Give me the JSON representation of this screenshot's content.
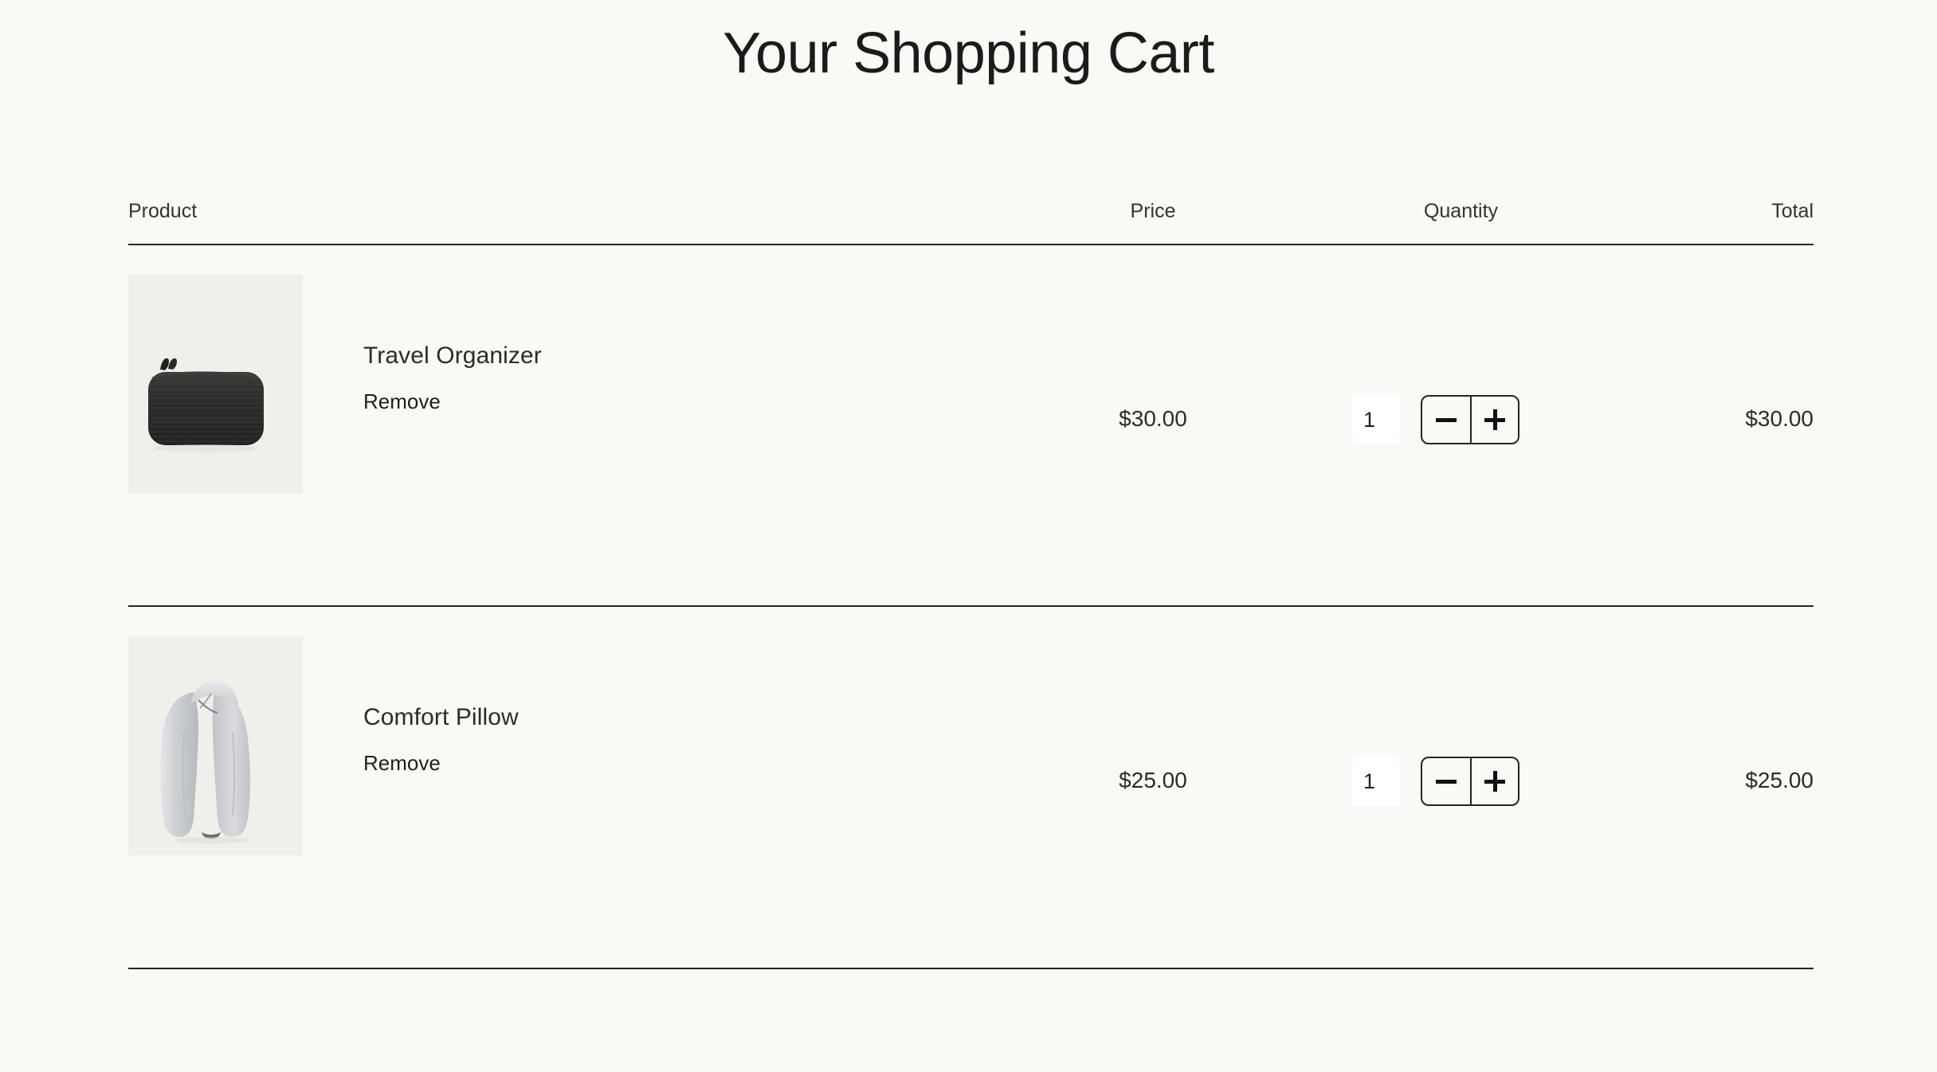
{
  "page": {
    "title": "Your Shopping Cart",
    "background_color": "#faf9f5",
    "divider_color": "#27271f",
    "text_color": "#1f1f1d"
  },
  "table": {
    "headers": {
      "product": "Product",
      "price": "Price",
      "quantity": "Quantity",
      "total": "Total"
    }
  },
  "items": [
    {
      "name": "Travel Organizer",
      "remove_label": "Remove",
      "price": "$30.00",
      "quantity": "1",
      "total": "$30.00",
      "image_name": "travel-organizer-pouch-image",
      "thumb_background": "#eff0e9",
      "product_color": "#2b2b2b"
    },
    {
      "name": "Comfort Pillow",
      "remove_label": "Remove",
      "price": "$25.00",
      "quantity": "1",
      "total": "$25.00",
      "image_name": "comfort-pillow-image",
      "thumb_background": "#eff0e9",
      "product_color": "#c9cbcd"
    }
  ],
  "stepper": {
    "decrease_label": "−",
    "increase_label": "+",
    "decrease_icon": "minus-icon",
    "increase_icon": "plus-icon"
  }
}
